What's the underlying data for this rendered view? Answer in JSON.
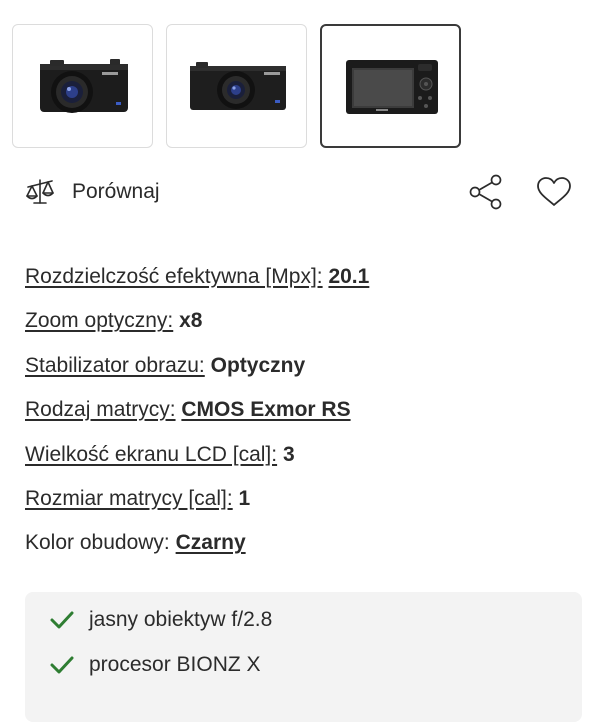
{
  "gallery": {
    "thumbnails": [
      {
        "alt": "camera-front-angled-view"
      },
      {
        "alt": "camera-front-view"
      },
      {
        "alt": "camera-back-view",
        "selected": true
      }
    ]
  },
  "actions": {
    "compare_label": "Porównaj",
    "compare_icon": "scale-icon",
    "share_icon": "share-icon",
    "favorite_icon": "heart-icon"
  },
  "specs": [
    {
      "label": "Rozdzielczość efektywna [Mpx]:",
      "value": "20.1"
    },
    {
      "label": "Zoom optyczny:",
      "value": "x8"
    },
    {
      "label": "Stabilizator obrazu:",
      "value": "Optyczny"
    },
    {
      "label": "Rodzaj matrycy:",
      "value": "CMOS Exmor RS"
    },
    {
      "label": "Wielkość ekranu LCD [cal]:",
      "value": "3"
    },
    {
      "label": "Rozmiar matrycy [cal]:",
      "value": "1"
    },
    {
      "label": "Kolor obudowy:",
      "value": "Czarny"
    }
  ],
  "features": [
    {
      "text": "jasny obiektyw f/2.8",
      "icon": "check-icon"
    },
    {
      "text": "procesor BIONZ X",
      "icon": "check-icon"
    }
  ],
  "colors": {
    "text": "#2b2b2b",
    "check": "#2e7d32",
    "feature_bg": "#f3f3f3",
    "thumb_border": "#dcdcdc",
    "thumb_selected_border": "#3a3a3a"
  }
}
